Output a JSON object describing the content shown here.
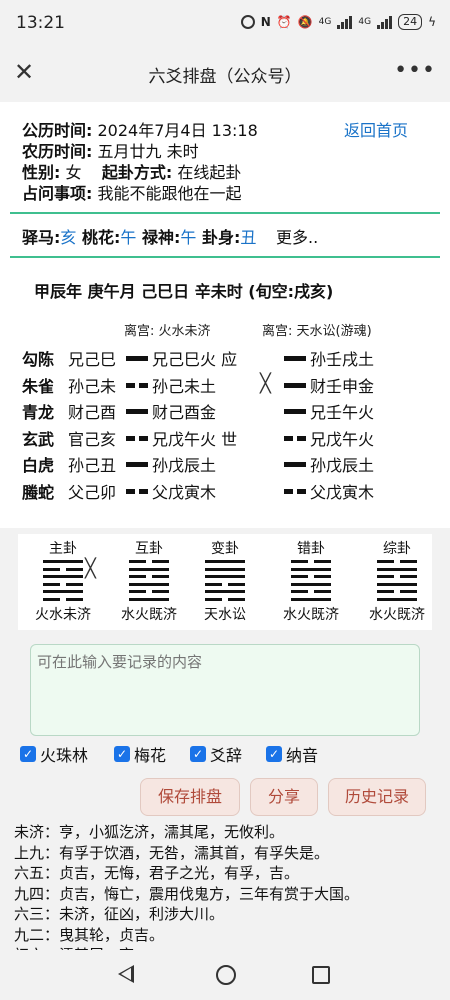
{
  "status": {
    "time": "13:21",
    "battery": "24",
    "net1": "4G",
    "net2": "4G"
  },
  "titlebar": {
    "title": "六爻排盘（公众号）",
    "close": "✕",
    "more": "•••"
  },
  "info": {
    "rows": [
      {
        "label": "公历时间:",
        "value": "2024年7月4日 13:18"
      },
      {
        "label": "农历时间:",
        "value": "五月廿九 未时"
      },
      {
        "label": "性别:",
        "value": "女"
      },
      {
        "label": "占问事项:",
        "value": "我能不能跟他在一起"
      }
    ],
    "qigua_label": "起卦方式:",
    "qigua_value": "在线起卦",
    "home_link": "返回首页"
  },
  "shensha": {
    "yima_label": "驿马:",
    "yima": "亥",
    "taohua_label": "桃花:",
    "taohua": "午",
    "lushen_label": "禄神:",
    "lushen": "午",
    "guashen_label": "卦身:",
    "guashen": "丑",
    "more": "更多.."
  },
  "ganzhi": "甲辰年 庚午月 己巳日 辛未时 (旬空:戌亥)",
  "main_gua_title": "离宫:  火水未济",
  "bian_gua_title": "离宫:  天水讼(游魂)",
  "yao_rows": [
    {
      "god": "勾陈",
      "fushen": "兄己巳",
      "main_line": "yang",
      "main_text": "兄己巳火 应",
      "moving": false,
      "bian_line": "yang",
      "bian_text": "孙壬戌土"
    },
    {
      "god": "朱雀",
      "fushen": "孙己未",
      "main_line": "yin",
      "main_text": "孙己未土",
      "moving": true,
      "move_mark": "╳",
      "bian_line": "yang",
      "bian_text": "财壬申金"
    },
    {
      "god": "青龙",
      "fushen": "财己酉",
      "main_line": "yang",
      "main_text": "财己酉金",
      "moving": false,
      "bian_line": "yang",
      "bian_text": "兄壬午火"
    },
    {
      "god": "玄武",
      "fushen": "官己亥",
      "main_line": "yin",
      "main_text": "兄戊午火 世",
      "moving": false,
      "bian_line": "yin",
      "bian_text": "兄戊午火"
    },
    {
      "god": "白虎",
      "fushen": "孙己丑",
      "main_line": "yang",
      "main_text": "孙戊辰土",
      "moving": false,
      "bian_line": "yang",
      "bian_text": "孙戊辰土"
    },
    {
      "god": "螣蛇",
      "fushen": "父己卯",
      "main_line": "yin",
      "main_text": "父戊寅木",
      "moving": false,
      "bian_line": "yin",
      "bian_text": "父戊寅木"
    }
  ],
  "gua_cards": [
    {
      "label": "主卦",
      "name": "火水未济",
      "lines": [
        "yang",
        "yin",
        "yang",
        "yin",
        "yang",
        "yin"
      ],
      "move_mark": "╳"
    },
    {
      "label": "互卦",
      "name": "水火既济",
      "lines": [
        "yin",
        "yang",
        "yin",
        "yang",
        "yin",
        "yang"
      ],
      "move_mark": ""
    },
    {
      "label": "变卦",
      "name": "天水讼",
      "lines": [
        "yang",
        "yang",
        "yang",
        "yin",
        "yang",
        "yin"
      ],
      "move_mark": ""
    },
    {
      "label": "错卦",
      "name": "水火既济",
      "lines": [
        "yin",
        "yang",
        "yin",
        "yang",
        "yin",
        "yang"
      ],
      "move_mark": ""
    },
    {
      "label": "综卦",
      "name": "水火既济",
      "lines": [
        "yin",
        "yang",
        "yin",
        "yang",
        "yin",
        "yang"
      ],
      "move_mark": ""
    }
  ],
  "notes": {
    "placeholder": "可在此输入要记录的内容"
  },
  "checkboxes": [
    {
      "label": "火珠林",
      "checked": true
    },
    {
      "label": "梅花",
      "checked": true
    },
    {
      "label": "爻辞",
      "checked": true
    },
    {
      "label": "纳音",
      "checked": true
    }
  ],
  "buttons": {
    "save": "保存排盘",
    "share": "分享",
    "history": "历史记录"
  },
  "text_lines": [
    "未济：亨，小狐汔济，濡其尾，无攸利。",
    "上九：有孚于饮酒，无咎，濡其首，有孚失是。",
    "六五：贞吉，无悔，君子之光，有孚，吉。",
    "九四：贞吉，悔亡，震用伐鬼方，三年有赏于大国。",
    "六三：未济，征凶，利涉大川。",
    "九二：曳其轮，贞吉。",
    "初六：濡其尾，吝。"
  ]
}
